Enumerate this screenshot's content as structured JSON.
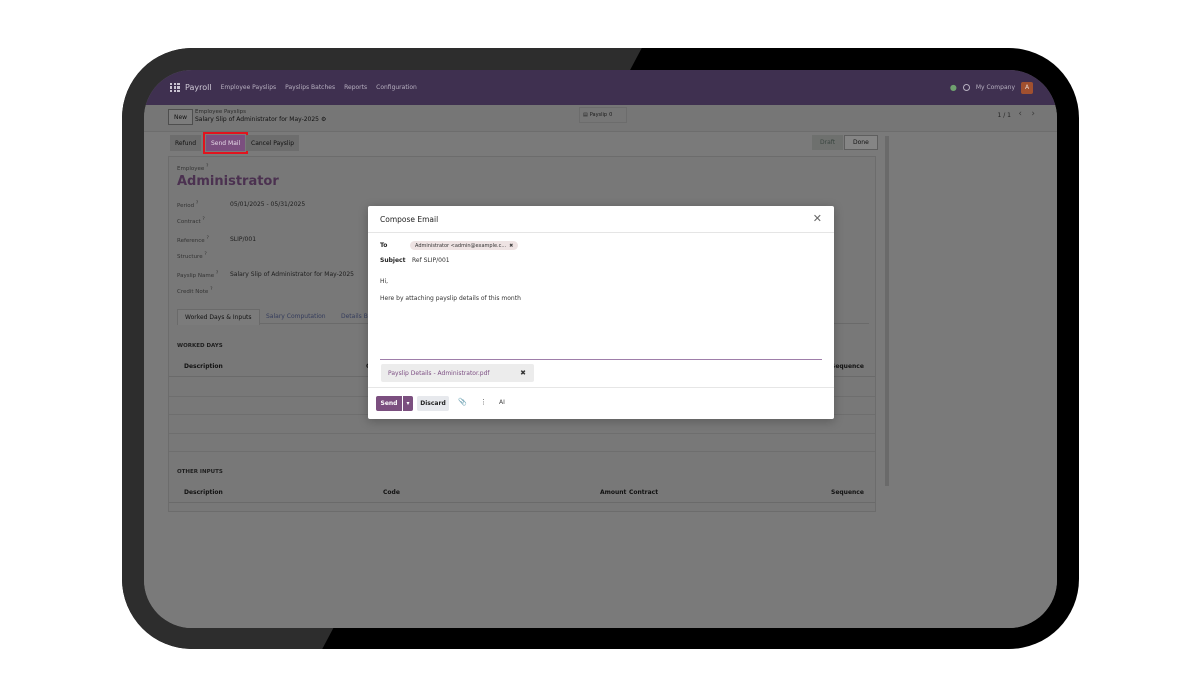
{
  "navbar": {
    "app": "Payroll",
    "menu": [
      "Employee Payslips",
      "Payslips Batches",
      "Reports",
      "Configuration"
    ],
    "company": "My Company",
    "avatar_initial": "A"
  },
  "control_panel": {
    "new_label": "New",
    "breadcrumb_parent": "Employee Payslips",
    "breadcrumb_current": "Salary Slip of Administrator for May-2025",
    "smart_button": "Payslip",
    "smart_count": "0",
    "pager": "1 / 1"
  },
  "status_bar": {
    "refund": "Refund",
    "send_mail": "Send Mail",
    "cancel_payslip": "Cancel Payslip",
    "states": [
      "Draft",
      "Done"
    ]
  },
  "form": {
    "employee_label": "Employee",
    "employee": "Administrator",
    "period_label": "Period",
    "period": "05/01/2025 - 05/31/2025",
    "contract_label": "Contract",
    "reference_label": "Reference",
    "reference": "SLIP/001",
    "structure_label": "Structure",
    "payslip_name_label": "Payslip Name",
    "payslip_name": "Salary Slip of Administrator for May-2025",
    "credit_note_label": "Credit Note",
    "tooltip_mark": "?",
    "tabs": [
      "Worked Days & Inputs",
      "Salary Computation",
      "Details B"
    ],
    "worked_days_title": "WORKED DAYS",
    "worked_days_cols": [
      "Description",
      "C",
      "Sequence"
    ],
    "other_inputs_title": "OTHER INPUTS",
    "other_inputs_cols": [
      "Description",
      "Code",
      "Amount",
      "Contract",
      "Sequence"
    ]
  },
  "modal": {
    "title": "Compose Email",
    "to_label": "To",
    "recipient": "Administrator <admin@example.c...",
    "subject_label": "Subject",
    "subject": "Ref SLIP/001",
    "body_greeting": "Hi,",
    "body_text": "Here by attaching payslip details of this month",
    "attachment": "Payslip Details - Administrator.pdf",
    "send": "Send",
    "discard": "Discard",
    "ai": "AI"
  },
  "colors": {
    "navbar": "#3f3050",
    "primary": "#7b4f7f",
    "highlight_outline": "#e1141e"
  }
}
